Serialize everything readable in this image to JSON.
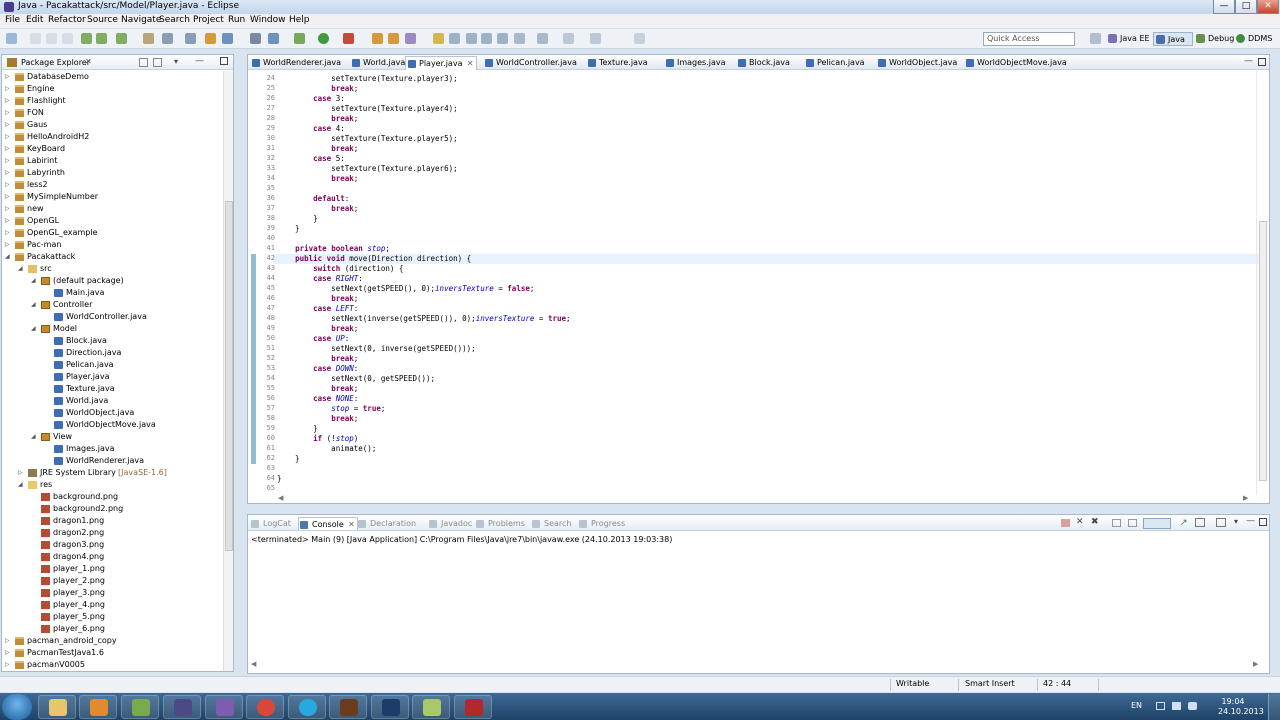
{
  "window": {
    "title": "Java - Pacakattack/src/Model/Player.java - Eclipse",
    "controls": [
      "minimize-icon",
      "maximize-icon",
      "close-icon"
    ]
  },
  "menu": [
    "File",
    "Edit",
    "Refactor",
    "Source",
    "Navigate",
    "Search",
    "Project",
    "Run",
    "Window",
    "Help"
  ],
  "toolbar": {
    "quick_access_placeholder": "Quick Access",
    "perspectives": [
      "Java EE",
      "Java",
      "Debug",
      "DDMS"
    ]
  },
  "package_explorer": {
    "title": "Package Explorer",
    "tree": [
      {
        "label": "DatabaseDemo",
        "depth": 0,
        "icon": "project",
        "expanded": false
      },
      {
        "label": "Engine",
        "depth": 0,
        "icon": "project",
        "expanded": false
      },
      {
        "label": "Flashlight",
        "depth": 0,
        "icon": "project",
        "expanded": false
      },
      {
        "label": "FON",
        "depth": 0,
        "icon": "project",
        "expanded": false
      },
      {
        "label": "Gaus",
        "depth": 0,
        "icon": "project",
        "expanded": false
      },
      {
        "label": "HelloAndroidH2",
        "depth": 0,
        "icon": "project",
        "expanded": false
      },
      {
        "label": "KeyBoard",
        "depth": 0,
        "icon": "project",
        "expanded": false
      },
      {
        "label": "Labirint",
        "depth": 0,
        "icon": "project",
        "expanded": false
      },
      {
        "label": "Labyrinth",
        "depth": 0,
        "icon": "project",
        "expanded": false
      },
      {
        "label": "less2",
        "depth": 0,
        "icon": "project",
        "expanded": false
      },
      {
        "label": "MySimpleNumber",
        "depth": 0,
        "icon": "project",
        "expanded": false
      },
      {
        "label": "new",
        "depth": 0,
        "icon": "project",
        "expanded": false
      },
      {
        "label": "OpenGL",
        "depth": 0,
        "icon": "project",
        "expanded": false
      },
      {
        "label": "OpenGL_example",
        "depth": 0,
        "icon": "project",
        "expanded": false
      },
      {
        "label": "Pac-man",
        "depth": 0,
        "icon": "project",
        "expanded": false
      },
      {
        "label": "Pacakattack",
        "depth": 0,
        "icon": "project",
        "expanded": true
      },
      {
        "label": "src",
        "depth": 1,
        "icon": "src",
        "expanded": true
      },
      {
        "label": "(default package)",
        "depth": 2,
        "icon": "package",
        "expanded": true
      },
      {
        "label": "Main.java",
        "depth": 3,
        "icon": "java",
        "expanded": false
      },
      {
        "label": "Controller",
        "depth": 2,
        "icon": "package",
        "expanded": true
      },
      {
        "label": "WorldController.java",
        "depth": 3,
        "icon": "java",
        "expanded": false
      },
      {
        "label": "Model",
        "depth": 2,
        "icon": "package",
        "expanded": true
      },
      {
        "label": "Block.java",
        "depth": 3,
        "icon": "java",
        "expanded": false
      },
      {
        "label": "Direction.java",
        "depth": 3,
        "icon": "java",
        "expanded": false
      },
      {
        "label": "Pelican.java",
        "depth": 3,
        "icon": "java",
        "expanded": false
      },
      {
        "label": "Player.java",
        "depth": 3,
        "icon": "java",
        "expanded": false
      },
      {
        "label": "Texture.java",
        "depth": 3,
        "icon": "java",
        "expanded": false
      },
      {
        "label": "World.java",
        "depth": 3,
        "icon": "java",
        "expanded": false
      },
      {
        "label": "WorldObject.java",
        "depth": 3,
        "icon": "java",
        "expanded": false
      },
      {
        "label": "WorldObjectMove.java",
        "depth": 3,
        "icon": "java",
        "expanded": false
      },
      {
        "label": "View",
        "depth": 2,
        "icon": "package",
        "expanded": true
      },
      {
        "label": "Images.java",
        "depth": 3,
        "icon": "java",
        "expanded": false
      },
      {
        "label": "WorldRenderer.java",
        "depth": 3,
        "icon": "java",
        "expanded": false
      },
      {
        "label": "JRE System Library",
        "suffix": "[JavaSE-1.6]",
        "depth": 1,
        "icon": "library",
        "expanded": false
      },
      {
        "label": "res",
        "depth": 1,
        "icon": "folder",
        "expanded": true
      },
      {
        "label": "background.png",
        "depth": 2,
        "icon": "png",
        "expanded": false
      },
      {
        "label": "background2.png",
        "depth": 2,
        "icon": "png",
        "expanded": false
      },
      {
        "label": "dragon1.png",
        "depth": 2,
        "icon": "png",
        "expanded": false
      },
      {
        "label": "dragon2.png",
        "depth": 2,
        "icon": "png",
        "expanded": false
      },
      {
        "label": "dragon3.png",
        "depth": 2,
        "icon": "png",
        "expanded": false
      },
      {
        "label": "dragon4.png",
        "depth": 2,
        "icon": "png",
        "expanded": false
      },
      {
        "label": "player_1.png",
        "depth": 2,
        "icon": "png",
        "expanded": false
      },
      {
        "label": "player_2.png",
        "depth": 2,
        "icon": "png",
        "expanded": false
      },
      {
        "label": "player_3.png",
        "depth": 2,
        "icon": "png",
        "expanded": false
      },
      {
        "label": "player_4.png",
        "depth": 2,
        "icon": "png",
        "expanded": false
      },
      {
        "label": "player_5.png",
        "depth": 2,
        "icon": "png",
        "expanded": false
      },
      {
        "label": "player_6.png",
        "depth": 2,
        "icon": "png",
        "expanded": false
      },
      {
        "label": "pacman_android_copy",
        "depth": 0,
        "icon": "project",
        "expanded": false
      },
      {
        "label": "PacmanTestJava1.6",
        "depth": 0,
        "icon": "project",
        "expanded": false
      },
      {
        "label": "pacmanV0005",
        "depth": 0,
        "icon": "project",
        "expanded": false
      }
    ]
  },
  "editor": {
    "tabs": [
      "WorldRenderer.java",
      "World.java",
      "Player.java",
      "WorldController.java",
      "Texture.java",
      "Images.java",
      "Block.java",
      "Pelican.java",
      "WorldObject.java",
      "WorldObjectMove.java"
    ],
    "active_tab": "Player.java",
    "first_line_number": 24,
    "current_line_number": 42,
    "code_lines": [
      "            setTexture(Texture.player3);",
      "            break;",
      "        case 3:",
      "            setTexture(Texture.player4);",
      "            break;",
      "        case 4:",
      "            setTexture(Texture.player5);",
      "            break;",
      "        case 5:",
      "            setTexture(Texture.player6);",
      "            break;",
      "",
      "        default:",
      "            break;",
      "        }",
      "    }",
      "",
      "    private boolean stop;",
      "    public void move(Direction direction) {",
      "        switch (direction) {",
      "        case RIGHT:",
      "            setNext(getSPEED(), 0);inversTexture = false;",
      "            break;",
      "        case LEFT:",
      "            setNext(inverse(getSPEED()), 0);inversTexture = true;",
      "            break;",
      "        case UP:",
      "            setNext(0, inverse(getSPEED()));",
      "            break;",
      "        case DOWN:",
      "            setNext(0, getSPEED());",
      "            break;",
      "        case NONE:",
      "            stop = true;",
      "            break;",
      "        }",
      "        if (!stop)",
      "            animate();",
      "    }",
      "",
      "}",
      ""
    ]
  },
  "console": {
    "tabs": [
      "LogCat",
      "Console",
      "Declaration",
      "Javadoc",
      "Problems",
      "Search",
      "Progress"
    ],
    "active_tab": "Console",
    "status_line": "<terminated> Main (9) [Java Application] C:\\Program Files\\Java\\jre7\\bin\\javaw.exe (24.10.2013 19:03:38)"
  },
  "status_bar": {
    "mode": "Writable",
    "insert_mode": "Smart Insert",
    "position": "42 : 44"
  },
  "taskbar": {
    "language": "EN",
    "time": "19:04",
    "date": "24.10.2013",
    "apps": [
      "start-orb",
      "file-explorer",
      "media-player",
      "android-sdk-app",
      "eclipse-app",
      "visual-studio-app",
      "chrome-app",
      "skype-app",
      "game-app",
      "photoshop-app",
      "notepad-app",
      "media-app"
    ]
  }
}
